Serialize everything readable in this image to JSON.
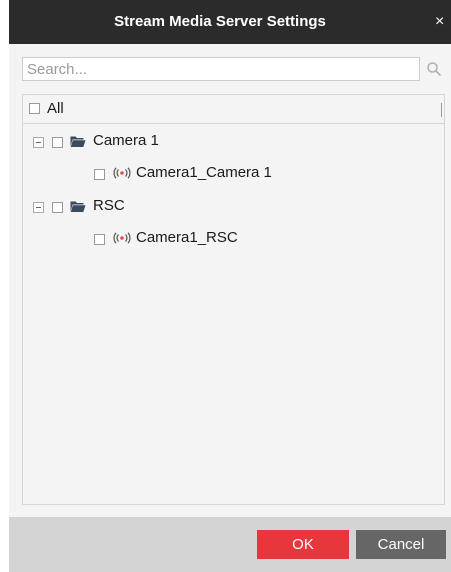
{
  "dialog": {
    "title": "Stream Media Server Settings",
    "close_glyph": "×"
  },
  "search": {
    "placeholder": "Search...",
    "value": "",
    "icon": "search-icon"
  },
  "tree": {
    "header_label": "All",
    "nodes": [
      {
        "label": "Camera 1",
        "icon": "folder-icon",
        "expanded": true,
        "children": [
          {
            "label": "Camera1_Camera 1",
            "icon": "camera-signal-icon"
          }
        ]
      },
      {
        "label": "RSC",
        "icon": "folder-icon",
        "expanded": true,
        "children": [
          {
            "label": "Camera1_RSC",
            "icon": "camera-signal-icon"
          }
        ]
      }
    ]
  },
  "footer": {
    "ok_label": "OK",
    "cancel_label": "Cancel"
  },
  "colors": {
    "titlebar": "#2b2b2b",
    "ok_button": "#e8363d",
    "cancel_button": "#666666",
    "footer": "#d4d4d4",
    "panel": "#f4f4f4",
    "folder": "#3b4a5c",
    "camera_icon": "#d9534f"
  }
}
